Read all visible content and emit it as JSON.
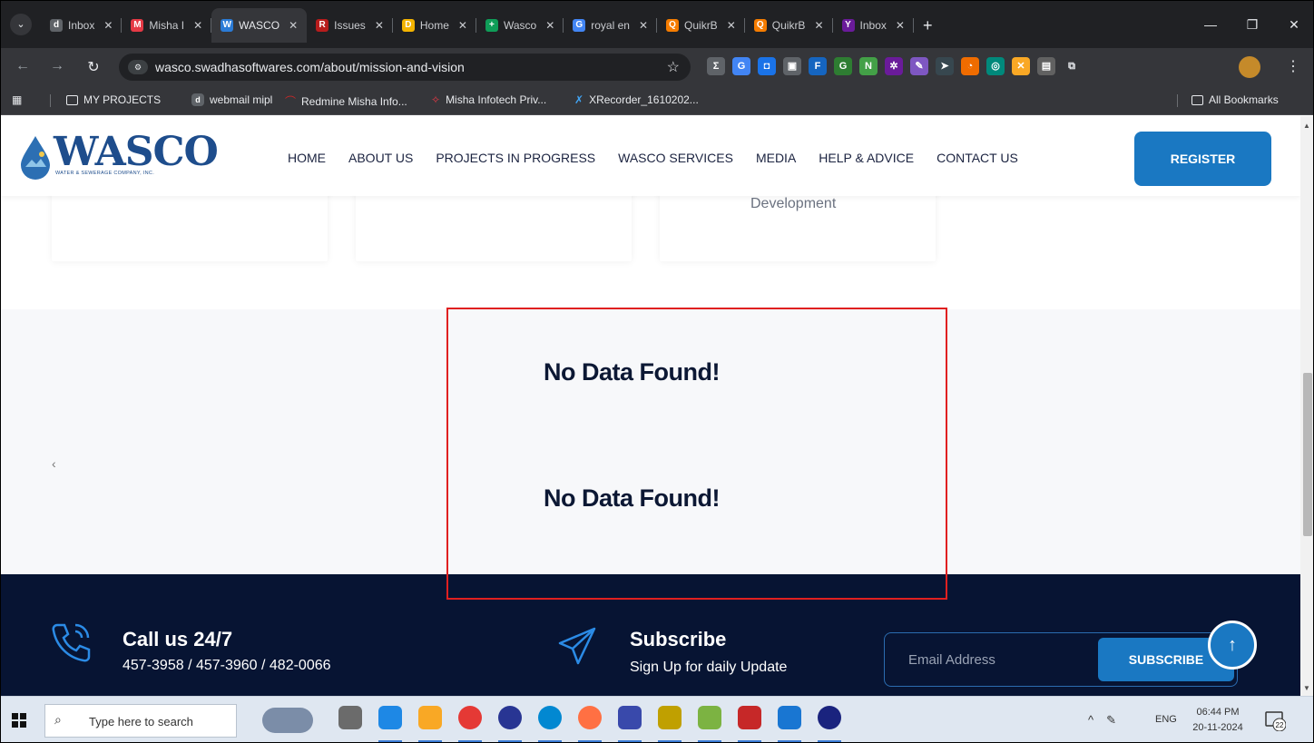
{
  "browser": {
    "tabs": [
      {
        "label": "Inbox",
        "fav_color": "#5f6368",
        "fav_glyph": "d"
      },
      {
        "label": "Misha I",
        "fav_color": "#e53945",
        "fav_glyph": "M"
      },
      {
        "label": "WASCO",
        "fav_color": "#2b7bd6",
        "fav_glyph": "W",
        "active": true
      },
      {
        "label": "Issues",
        "fav_color": "#b71c1c",
        "fav_glyph": "R"
      },
      {
        "label": "Home",
        "fav_color": "#f4b400",
        "fav_glyph": "D"
      },
      {
        "label": "Wasco",
        "fav_color": "#0f9d58",
        "fav_glyph": "+"
      },
      {
        "label": "royal en",
        "fav_color": "#4285f4",
        "fav_glyph": "G"
      },
      {
        "label": "QuikrB",
        "fav_color": "#f57c00",
        "fav_glyph": "Q"
      },
      {
        "label": "QuikrB",
        "fav_color": "#f57c00",
        "fav_glyph": "Q"
      },
      {
        "label": "Inbox",
        "fav_color": "#6a1b9a",
        "fav_glyph": "Y"
      }
    ],
    "url": "wasco.swadhasoftwares.com/about/mission-and-vision",
    "bookmarks": [
      {
        "label": "MY PROJECTS"
      },
      {
        "label": "webmail mipl"
      },
      {
        "label": "Redmine Misha Info..."
      },
      {
        "label": "Misha Infotech Priv..."
      },
      {
        "label": "XRecorder_1610202..."
      }
    ],
    "all_bookmarks": "All Bookmarks"
  },
  "site": {
    "logo_word": "WASCO",
    "logo_tagline": "WATER & SEWERAGE COMPANY, INC.",
    "nav": [
      "HOME",
      "ABOUT US",
      "PROJECTS IN PROGRESS",
      "WASCO SERVICES",
      "MEDIA",
      "HELP & ADVICE",
      "CONTACT US"
    ],
    "register_label": "REGISTER",
    "card_text": "Development",
    "no_data_1": "No Data Found!",
    "no_data_2": "No Data Found!",
    "carousel_prev": "‹"
  },
  "footer": {
    "call_title": "Call us 24/7",
    "call_numbers": "457-3958 / 457-3960 / 482-0066",
    "subscribe_title": "Subscribe",
    "subscribe_text": "Sign Up for daily Update",
    "email_placeholder": "Email Address",
    "subscribe_button": "SUBSCRIBE"
  },
  "taskbar": {
    "search_placeholder": "Type here to search",
    "lang": "ENG",
    "time": "06:44 PM",
    "date": "20-11-2024",
    "notification_count": "22"
  },
  "colors": {
    "accent_blue": "#1a78c2",
    "navy": "#071433",
    "highlight_red": "#e02020"
  }
}
